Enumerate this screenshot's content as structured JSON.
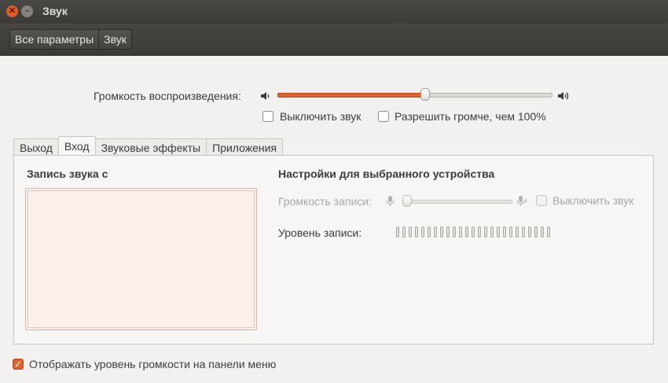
{
  "window": {
    "title": "Звук"
  },
  "toolbar": {
    "breadcrumbs": [
      "Все параметры",
      "Звук"
    ]
  },
  "output_volume": {
    "label": "Громкость воспроизведения:",
    "level_percent": 54
  },
  "options": {
    "mute_label": "Выключить звук",
    "mute": false,
    "allow_louder_label": "Разрешить громче, чем 100%",
    "allow_louder": false
  },
  "tabs": [
    {
      "label": "Выход",
      "active": false
    },
    {
      "label": "Вход",
      "active": true
    },
    {
      "label": "Звуковые эффекты",
      "active": false
    },
    {
      "label": "Приложения",
      "active": false
    }
  ],
  "input": {
    "record_from_label": "Запись звука с",
    "device_settings_title": "Настройки для выбранного устройства",
    "record_volume_label": "Громкость записи:",
    "record_volume_percent": 0,
    "record_mute_label": "Выключить звук",
    "record_level_label": "Уровень записи:",
    "level_bar_count": 25
  },
  "footer": {
    "show_volume_label": "Отображать уровень громкости на панели меню",
    "show_volume": true
  },
  "colors": {
    "accent": "#e0632e",
    "titlebar": "#3c3b37",
    "background": "#f2f1f0"
  }
}
